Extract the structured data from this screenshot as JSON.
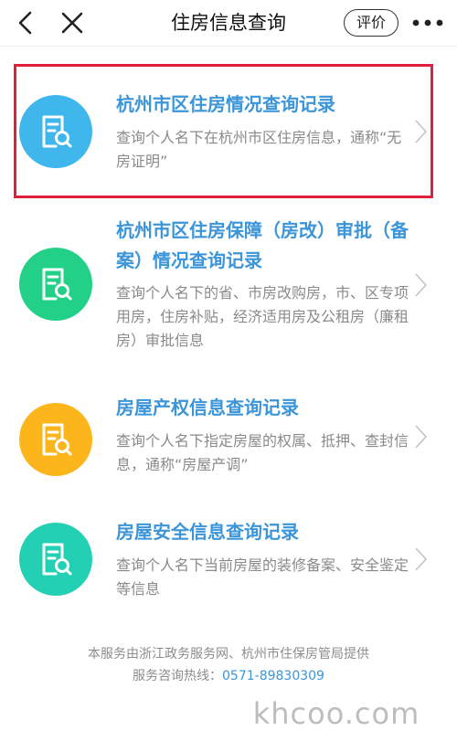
{
  "nav": {
    "title": "住房信息查询",
    "rate_label": "评价",
    "icons": [
      "back-icon",
      "close-icon",
      "more-icon"
    ]
  },
  "items": [
    {
      "title": "杭州市区住房情况查询记录",
      "desc": "查询个人名下在杭州市区住房信息，通称“无房证明”",
      "icon": "document-search-icon",
      "color": "#3fb6ec"
    },
    {
      "title": "杭州市区住房保障（房改）审批（备案）情况查询记录",
      "desc": "查询个人名下的省、市房改购房，市、区专项用房，住房补贴，经济适用房及公租房（廉租房）审批信息",
      "icon": "document-search-icon",
      "color": "#22d187"
    },
    {
      "title": "房屋产权信息查询记录",
      "desc": "查询个人名下指定房屋的权属、抵押、查封信息，通称“房屋产调”",
      "icon": "document-search-icon",
      "color": "#fcb51b"
    },
    {
      "title": "房屋安全信息查询记录",
      "desc": "查询个人名下当前房屋的装修备案、安全鉴定等信息",
      "icon": "document-search-icon",
      "color": "#24d0b3"
    }
  ],
  "footer": {
    "provider": "本服务由浙江政务服务网、杭州市住保房管局提供",
    "hotline_label": "服务咨询热线：",
    "hotline_number": "0571-89830309"
  },
  "watermark": "khcoo.com",
  "colors": {
    "accent": "#3b95d8",
    "highlight_border": "#e0203a"
  }
}
